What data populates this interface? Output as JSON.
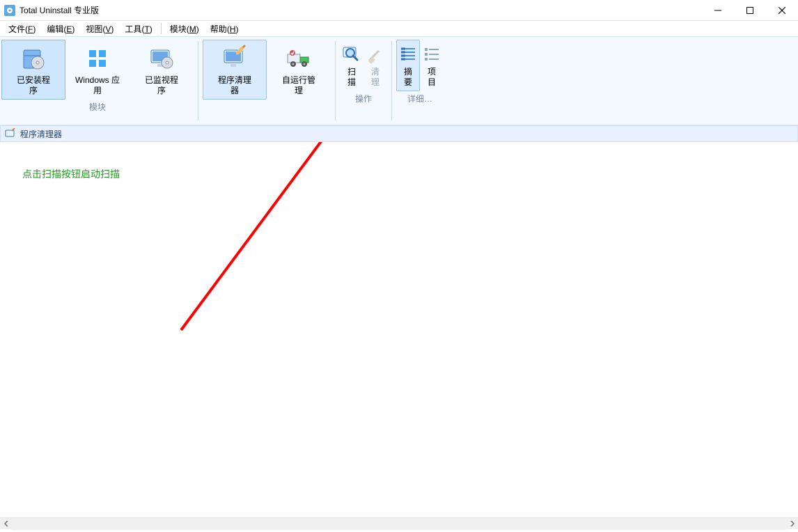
{
  "window": {
    "title": "Total Uninstall 专业版"
  },
  "menubar": {
    "items": [
      {
        "label": "文件",
        "hotkey": "F"
      },
      {
        "label": "编辑",
        "hotkey": "E"
      },
      {
        "label": "视图",
        "hotkey": "V"
      },
      {
        "label": "工具",
        "hotkey": "T"
      },
      {
        "label": "模块",
        "hotkey": "M"
      },
      {
        "label": "帮助",
        "hotkey": "H"
      }
    ]
  },
  "ribbon": {
    "groups": [
      {
        "name": "modules",
        "label": "模块",
        "buttons": [
          {
            "id": "installed-programs",
            "label": "已安装程\n序",
            "active": true
          },
          {
            "id": "windows-apps",
            "label": "Windows 应\n用"
          },
          {
            "id": "monitored-programs",
            "label": "已监视程\n序"
          }
        ]
      },
      {
        "name": "cleaner",
        "label": "",
        "buttons": [
          {
            "id": "program-cleaner",
            "label": "程序清理\n器",
            "active": true
          },
          {
            "id": "autorun-manager",
            "label": "自运行管\n理"
          }
        ]
      },
      {
        "name": "actions",
        "label": "操作",
        "buttons": [
          {
            "id": "scan",
            "label": "扫\n描"
          },
          {
            "id": "clean",
            "label": "清\n理",
            "disabled": true
          }
        ]
      },
      {
        "name": "details",
        "label": "详细…",
        "buttons": [
          {
            "id": "summary",
            "label": "摘\n要",
            "active": true
          },
          {
            "id": "items",
            "label": "项\n目"
          }
        ]
      }
    ]
  },
  "section": {
    "title": "程序清理器"
  },
  "content": {
    "hint": "点击扫描按钮启动扫描"
  },
  "icons": {
    "app": "app-icon",
    "minimize": "minimize-icon",
    "maximize": "maximize-icon",
    "close": "close-icon"
  }
}
